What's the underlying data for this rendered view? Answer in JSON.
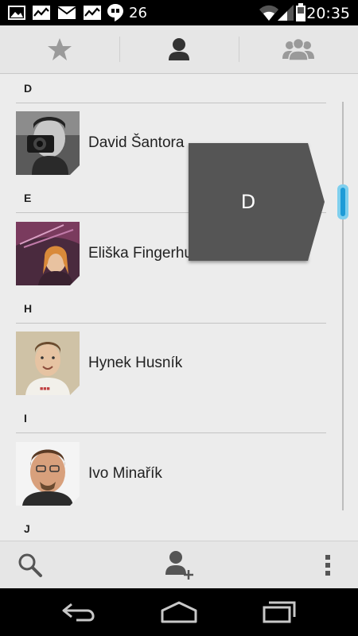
{
  "status_bar": {
    "notification_count": "26",
    "clock": "20:35",
    "icons": [
      "image-icon",
      "activity-icon",
      "gmail-icon",
      "activity-icon",
      "hangouts-icon",
      "wifi-icon",
      "signal-icon",
      "battery-icon"
    ]
  },
  "tabs": [
    {
      "icon": "star-icon",
      "active": false
    },
    {
      "icon": "person-icon",
      "active": true
    },
    {
      "icon": "group-icon",
      "active": false
    }
  ],
  "sections": [
    {
      "letter": "D",
      "contacts": [
        {
          "name": "David Šantora",
          "avatar": "photo"
        }
      ]
    },
    {
      "letter": "E",
      "contacts": [
        {
          "name": "Eliška Fingerhutová",
          "avatar": "photo"
        }
      ]
    },
    {
      "letter": "H",
      "contacts": [
        {
          "name": "Hynek Husník",
          "avatar": "photo"
        }
      ]
    },
    {
      "letter": "I",
      "contacts": [
        {
          "name": "Ivo Minařík",
          "avatar": "photo"
        }
      ]
    },
    {
      "letter": "J",
      "contacts": []
    }
  ],
  "fast_scroll": {
    "letter": "D"
  },
  "action_bar": {
    "icons": [
      "search-icon",
      "add-contact-icon",
      "overflow-menu-icon"
    ]
  },
  "nav_bar": {
    "icons": [
      "back-icon",
      "home-icon",
      "recents-icon"
    ]
  },
  "colors": {
    "accent": "#1e9bd7",
    "bubble": "#555555",
    "background": "#ececec"
  }
}
